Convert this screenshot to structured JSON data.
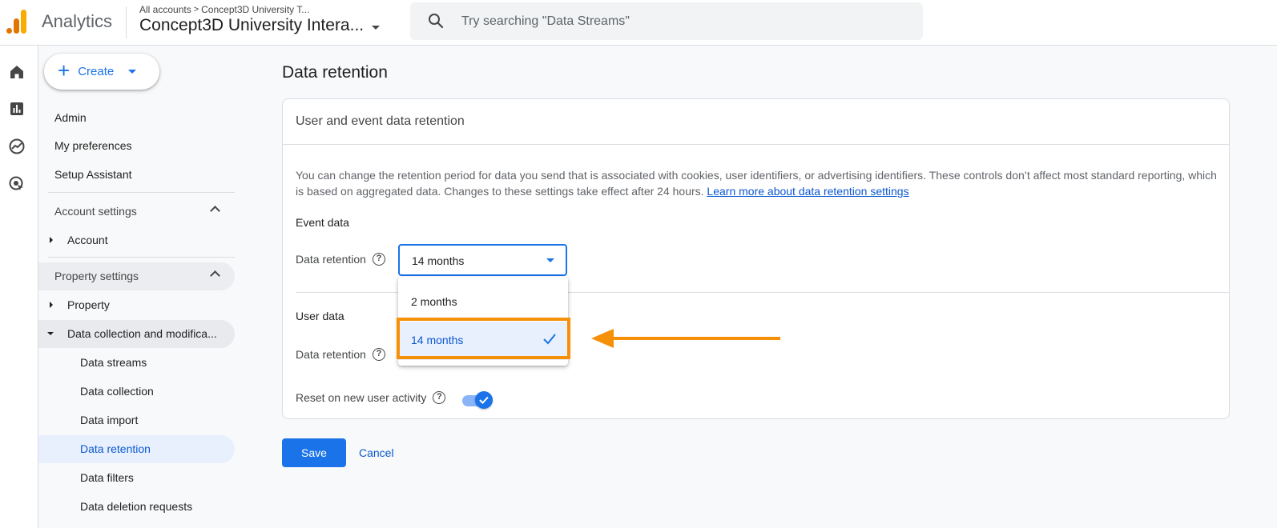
{
  "header": {
    "app_name": "Analytics",
    "breadcrumb_root": "All accounts",
    "breadcrumb_account": "Concept3D University T...",
    "property_name": "Concept3D University Intera...",
    "search_placeholder": "Try searching \"Data Streams\""
  },
  "nav": {
    "create_label": "Create",
    "top_items": [
      "Admin",
      "My preferences",
      "Setup Assistant"
    ],
    "account_settings": "Account settings",
    "account": "Account",
    "property_settings": "Property settings",
    "property": "Property",
    "data_collection_group": "Data collection and modifica...",
    "sub_items": [
      "Data streams",
      "Data collection",
      "Data import",
      "Data retention",
      "Data filters",
      "Data deletion requests"
    ],
    "active_item": "Data retention"
  },
  "main": {
    "title": "Data retention",
    "card_title": "User and event data retention",
    "description": "You can change the retention period for data you send that is associated with cookies, user identifiers, or advertising identifiers. These controls don’t affect most standard reporting, which is based on aggregated data. Changes to these settings take effect after 24 hours.",
    "learn_more": "Learn more about data retention settings",
    "event_data_label": "Event data",
    "data_retention_label": "Data retention",
    "event_retention_value": "14 months",
    "user_data_label": "User data",
    "reset_label": "Reset on new user activity",
    "reset_enabled": true,
    "save_label": "Save",
    "cancel_label": "Cancel"
  },
  "dropdown": {
    "options": [
      "2 months",
      "14 months"
    ],
    "selected": "14 months"
  },
  "colors": {
    "primary": "#1a73e8",
    "highlight": "#f79009"
  }
}
